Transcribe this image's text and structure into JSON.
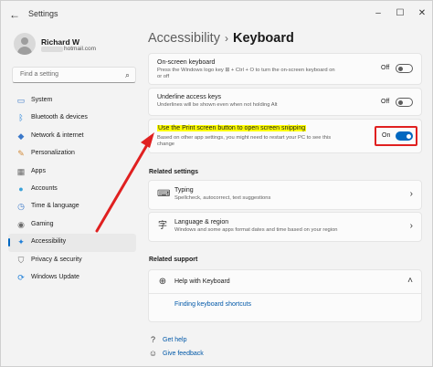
{
  "window": {
    "app_title": "Settings",
    "back_icon": "back-arrow-icon",
    "controls": {
      "minimize": "–",
      "maximize": "☐",
      "close": "✕"
    }
  },
  "profile": {
    "name": "Richard W",
    "email_suffix": "hotmail.com"
  },
  "search": {
    "placeholder": "Find a setting"
  },
  "nav": {
    "items": [
      {
        "label": "System",
        "icon": "monitor-icon",
        "color": "#3a78c9"
      },
      {
        "label": "Bluetooth & devices",
        "icon": "bluetooth-icon",
        "color": "#1f7fd8"
      },
      {
        "label": "Network & internet",
        "icon": "wifi-icon",
        "color": "#3a78c9"
      },
      {
        "label": "Personalization",
        "icon": "brush-icon",
        "color": "#d28a3a"
      },
      {
        "label": "Apps",
        "icon": "apps-icon",
        "color": "#6a6a6a"
      },
      {
        "label": "Accounts",
        "icon": "person-icon",
        "color": "#3aa2d9"
      },
      {
        "label": "Time & language",
        "icon": "globe-clock-icon",
        "color": "#3a78c9"
      },
      {
        "label": "Gaming",
        "icon": "controller-icon",
        "color": "#6a6a6a"
      },
      {
        "label": "Accessibility",
        "icon": "accessibility-icon",
        "color": "#1f7fd8",
        "active": true
      },
      {
        "label": "Privacy & security",
        "icon": "shield-icon",
        "color": "#6a6a6a"
      },
      {
        "label": "Windows Update",
        "icon": "update-icon",
        "color": "#1f7fd8"
      }
    ]
  },
  "breadcrumb": {
    "parent": "Accessibility",
    "separator": "›",
    "current": "Keyboard"
  },
  "settings": {
    "onscreen": {
      "title": "On-screen keyboard",
      "desc": "Press the Windows logo key ⊞ + Ctrl + O to turn the on-screen keyboard on",
      "desc2": "or off",
      "state": "Off"
    },
    "underline": {
      "title": "Underline access keys",
      "desc": "Underlines will be shown even when not holding Alt",
      "state": "Off"
    },
    "printscreen": {
      "title": "Use the Print screen button to open screen snipping",
      "desc": "Based on other app settings, you might need to restart your PC to see this",
      "desc2": "change",
      "state": "On"
    }
  },
  "related_settings": {
    "title": "Related settings",
    "items": [
      {
        "title": "Typing",
        "desc": "Spellcheck, autocorrect, text suggestions",
        "icon": "keyboard-icon"
      },
      {
        "title": "Language & region",
        "desc": "Windows and some apps format dates and time based on your region",
        "icon": "language-icon"
      }
    ]
  },
  "related_support": {
    "title": "Related support",
    "help_title": "Help with Keyboard",
    "help_link": "Finding keyboard shortcuts"
  },
  "footer": {
    "get_help": "Get help",
    "give_feedback": "Give feedback"
  },
  "colors": {
    "accent": "#0067c0",
    "annotation_red": "#e02020",
    "highlight": "#ffff00"
  }
}
